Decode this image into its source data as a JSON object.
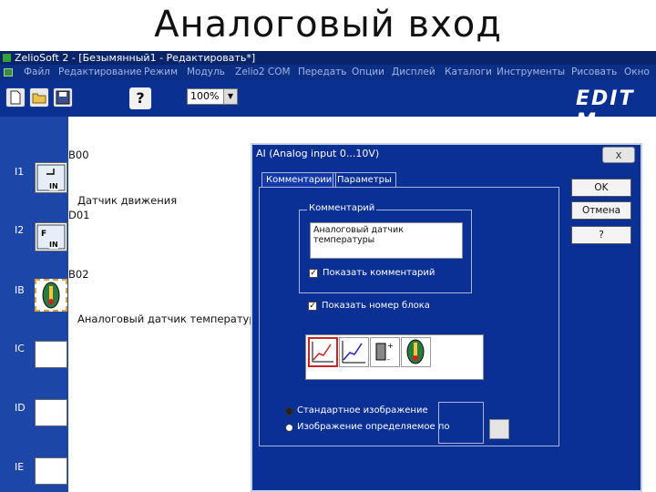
{
  "slide_title": "Аналоговый вход",
  "window": {
    "title": "ZelioSoft 2 - [Безымянный1 - Редактировать*]"
  },
  "menu": [
    "Файл",
    "Редактирование",
    "Режим",
    "Модуль",
    "Zelio2 COM",
    "Передать",
    "Опции",
    "Дисплей",
    "Каталоги",
    "Инструменты",
    "Рисовать",
    "Окно"
  ],
  "toolbar": {
    "zoom_value": "100%",
    "help_label": "?",
    "logo": "EDIT M"
  },
  "rows": [
    "I1",
    "I2",
    "IB",
    "IC",
    "ID",
    "IE"
  ],
  "blocks": {
    "b00": "B00",
    "label_motion": "Датчик движения",
    "d01": "D01",
    "b02": "B02",
    "label_temp": "Аналоговый датчик температуры",
    "in1": "IN",
    "in2": "IN"
  },
  "dialog": {
    "title": "AI (Analog input 0...10V)",
    "close": "x",
    "tabs": [
      "Комментарии",
      "Параметры"
    ],
    "group_label": "Комментарий",
    "comment_text": "Аналоговый датчик температуры",
    "show_comment": "Показать комментарий",
    "show_block_number": "Показать номер блока",
    "radio_standard": "Стандартное изображение",
    "radio_custom": "Изображение определяемое по",
    "buttons": {
      "ok": "OK",
      "cancel": "Отмена",
      "help": "?"
    }
  },
  "colors": {
    "app_blue": "#0a3096",
    "titlebar": "#0a246a",
    "left_column": "#1c46a8"
  }
}
